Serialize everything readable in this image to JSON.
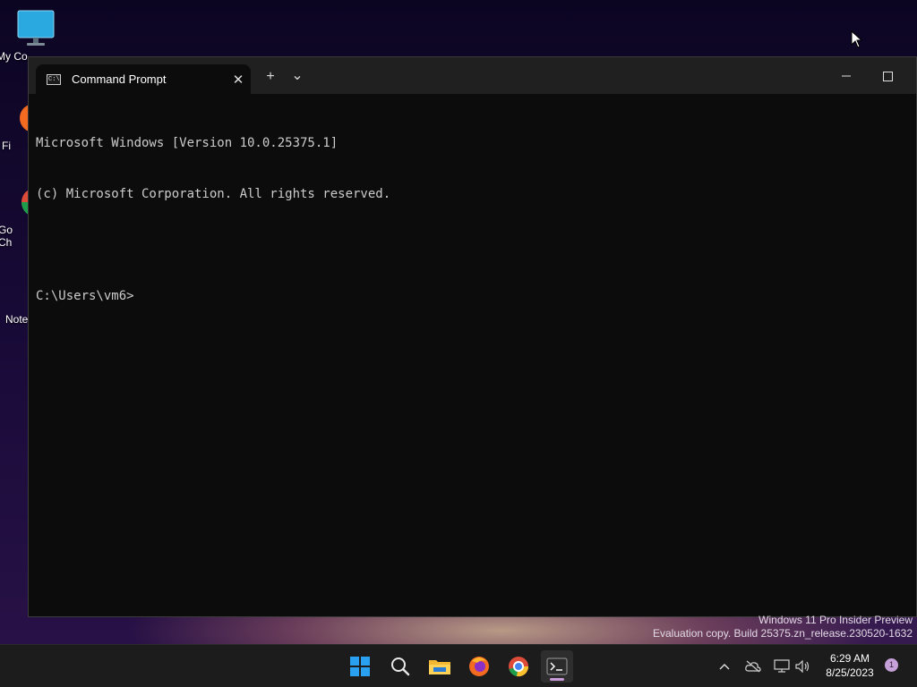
{
  "desktop": {
    "icons": [
      {
        "label": "My Co..."
      },
      {
        "label": "Fi"
      },
      {
        "label": "Go\nCh"
      },
      {
        "label": "Note"
      }
    ]
  },
  "window": {
    "tab_title": "Command Prompt",
    "tab_icon_text": "C:\\",
    "new_tab_symbol": "+",
    "dropdown_symbol": "⌄",
    "close_tab_symbol": "✕",
    "console_lines": [
      "Microsoft Windows [Version 10.0.25375.1]",
      "(c) Microsoft Corporation. All rights reserved.",
      "",
      "C:\\Users\\vm6>"
    ]
  },
  "watermark": {
    "line1": "Windows 11 Pro Insider Preview",
    "line2": "Evaluation copy. Build 25375.zn_release.230520-1632"
  },
  "taskbar": {
    "apps": [
      "start",
      "search",
      "file-explorer",
      "firefox",
      "chrome",
      "terminal"
    ],
    "clock_time": "6:29 AM",
    "clock_date": "8/25/2023",
    "notification_count": "1"
  },
  "colors": {
    "accent": "#c99bd8",
    "terminal_bg": "#0c0c0c",
    "titlebar_bg": "#202020"
  }
}
